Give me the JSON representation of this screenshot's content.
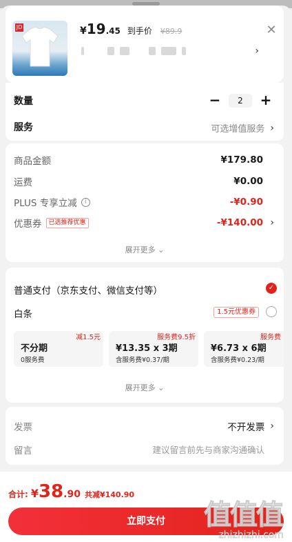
{
  "product": {
    "price_currency": "¥",
    "price_int": "19",
    "price_dec": ".45",
    "price_label": "到手价",
    "original_price": "¥89.9",
    "logo_text": "JD"
  },
  "quantity": {
    "label": "数量",
    "minus": "−",
    "value": "2",
    "plus": "+"
  },
  "service": {
    "label": "服务",
    "value": "可选增值服务"
  },
  "amounts": {
    "goods_label": "商品金额",
    "goods_value": "¥179.80",
    "shipping_label": "运费",
    "shipping_value": "¥0.00",
    "plus_label": "PLUS 专享立减",
    "plus_value": "-¥0.90",
    "coupon_label": "优惠券",
    "coupon_tag": "已选推荐优惠",
    "coupon_value": "-¥140.00",
    "more": "展开更多 ⌄"
  },
  "payment": {
    "normal_label": "普通支付（京东支付、微信支付等）",
    "baitiao_label": "白条",
    "baitiao_coupon": "1.5元优惠券",
    "plans": [
      {
        "tag": "减1.5元",
        "main": "不分期",
        "sub": "0服务费"
      },
      {
        "tag": "服务费9.5折",
        "main": "¥13.35 x 3期",
        "sub": "含服务费¥0.37/期"
      },
      {
        "tag": "服务费",
        "main": "¥6.73 x 6期",
        "sub": "含服务费¥0.23/期"
      }
    ],
    "more": "展开更多 ⌄"
  },
  "invoice": {
    "label": "发票",
    "value": "不开发票"
  },
  "memo": {
    "label": "留言",
    "placeholder": "建议留言前先与商家沟通确认"
  },
  "footer": {
    "total_label": "合计:",
    "total_currency": "¥",
    "total_int": "38",
    "total_dec": ".90",
    "total_save": "共减¥140.90",
    "pay_button": "立即支付",
    "watermark": "值值值",
    "watermark_url": "zhizhizhi.com"
  },
  "colors": {
    "accent": "#e2231a",
    "muted": "#888888"
  }
}
